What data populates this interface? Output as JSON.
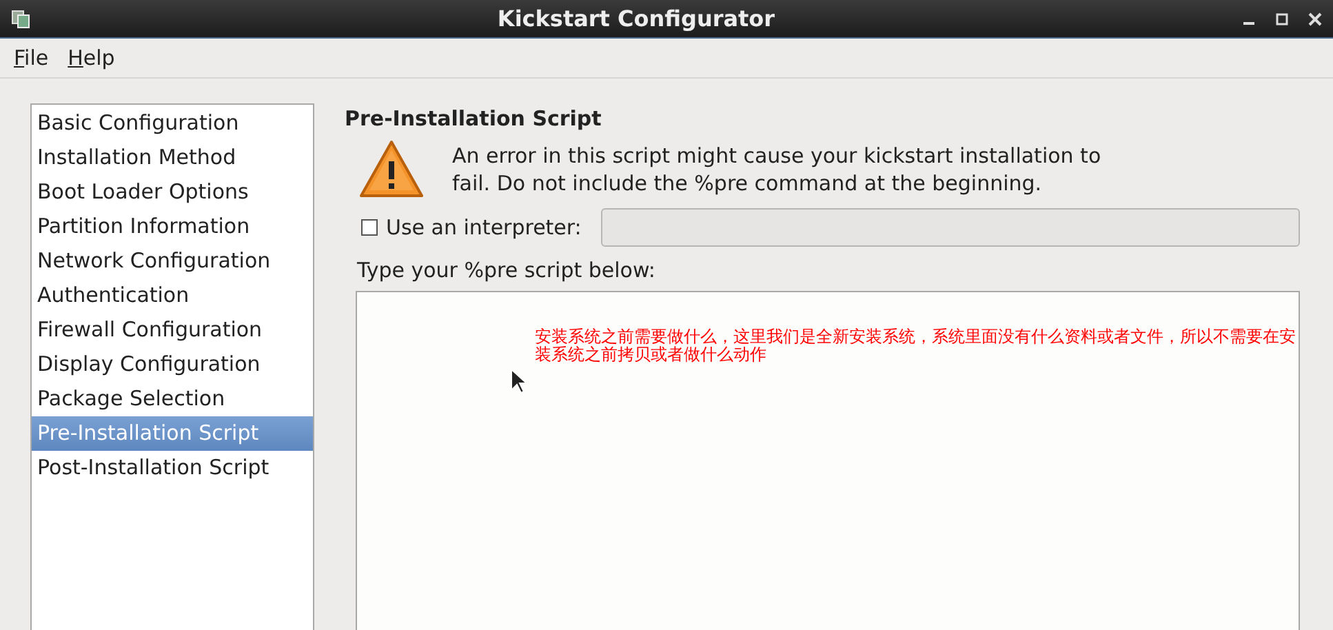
{
  "window": {
    "title": "Kickstart Configurator"
  },
  "menu": [
    "File",
    "Help"
  ],
  "sidebar": {
    "items": [
      {
        "label": "Basic Configuration",
        "selected": false
      },
      {
        "label": "Installation Method",
        "selected": false
      },
      {
        "label": "Boot Loader Options",
        "selected": false
      },
      {
        "label": "Partition Information",
        "selected": false
      },
      {
        "label": "Network Configuration",
        "selected": false
      },
      {
        "label": "Authentication",
        "selected": false
      },
      {
        "label": "Firewall Configuration",
        "selected": false
      },
      {
        "label": "Display Configuration",
        "selected": false
      },
      {
        "label": "Package Selection",
        "selected": false
      },
      {
        "label": "Pre-Installation Script",
        "selected": true
      },
      {
        "label": "Post-Installation Script",
        "selected": false
      }
    ]
  },
  "panel": {
    "heading": "Pre-Installation Script",
    "warning": "An error in this script might cause your kickstart installation to fail. Do not include the %pre command at the beginning.",
    "interpreter": {
      "label": "Use an interpreter:",
      "checked": false
    },
    "script_label": "Type your %pre script below:",
    "annotation": "安装系统之前需要做什么，这里我们是全新安装系统，系统里面没有什么资料或者文件，所以不需要在安装系统之前拷贝或者做什么动作"
  }
}
